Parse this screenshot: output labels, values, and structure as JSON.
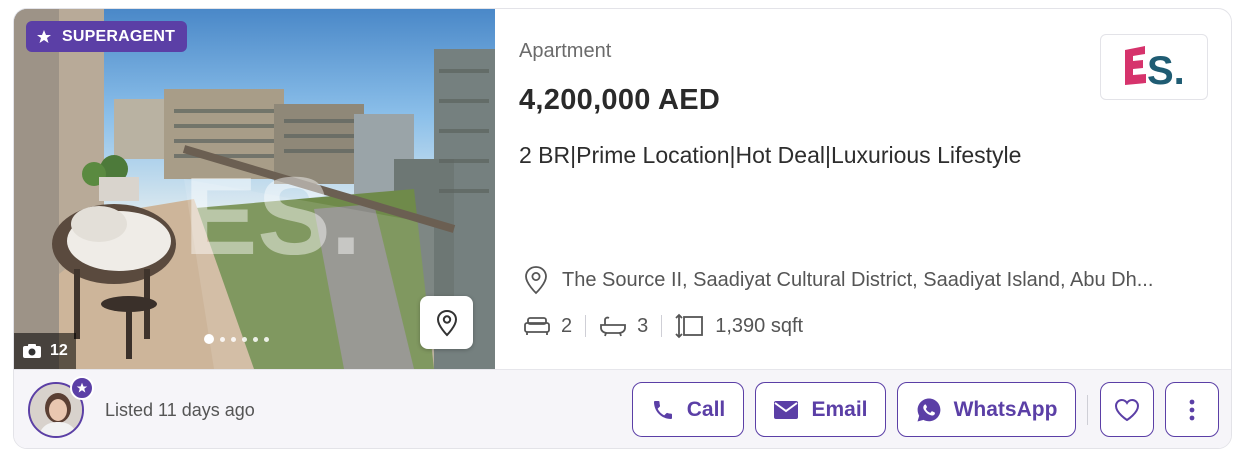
{
  "listing": {
    "badge": "SUPERAGENT",
    "photo_count": "12",
    "carousel_dots": 6,
    "property_type": "Apartment",
    "price": "4,200,000 AED",
    "title": "2 BR|Prime Location|Hot Deal|Luxurious Lifestyle",
    "location": "The Source II, Saadiyat Cultural District, Saadiyat Island, Abu Dh...",
    "bedrooms": "2",
    "bathrooms": "3",
    "area": "1,390 sqft",
    "watermark": "ES.",
    "agency_logo_text": "ES."
  },
  "footer": {
    "listed": "Listed 11 days ago",
    "call_label": "Call",
    "email_label": "Email",
    "whatsapp_label": "WhatsApp"
  },
  "icons": {
    "badge": "superagent-star-icon",
    "camera": "camera-icon",
    "map": "map-pin-icon",
    "location": "location-pin-icon",
    "bed": "bed-icon",
    "bath": "bathtub-icon",
    "area": "area-icon",
    "call": "phone-icon",
    "email": "envelope-icon",
    "whatsapp": "whatsapp-icon",
    "favorite": "heart-icon",
    "more": "more-vertical-icon"
  },
  "colors": {
    "accent": "#5b3fa6",
    "logo_pink": "#d6336c",
    "logo_teal": "#1f5c73"
  }
}
